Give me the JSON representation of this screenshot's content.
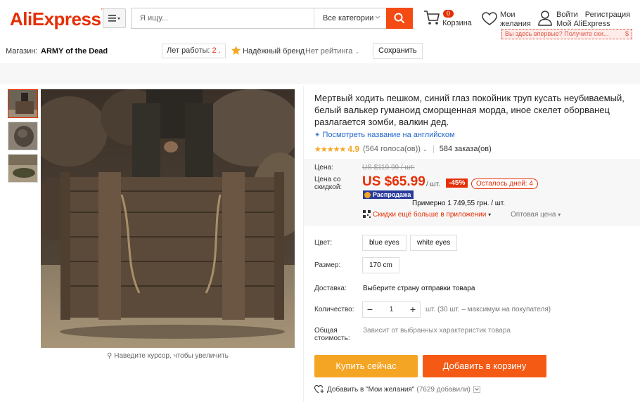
{
  "header": {
    "logo": "AliExpress",
    "search_placeholder": "Я ищу...",
    "category": "Все категории",
    "cart_count": "0",
    "cart_label": "Корзина",
    "wishlist_line1": "Мои",
    "wishlist_line2": "желания",
    "login": "Войти",
    "register": "Регистрация",
    "my_account": "Мой AliExpress",
    "promo": "Вы здесь впервые? Получите ски...",
    "promo_amount": "$"
  },
  "store": {
    "label": "Магазин:",
    "name": "ARMY of the Dead",
    "years_label": "Лет работы:",
    "years_value": "2 .",
    "brand": "Надёжный бренд",
    "rating": "Нет рейтинга",
    "save": "Сохранить"
  },
  "gallery": {
    "zoom_hint": "Наведите курсор, чтобы увеличить"
  },
  "product": {
    "title": "Мертвый ходить пешком, синий глаз покойник труп кусать неубиваемый, белый валькер гуманоид сморщенная морда, иное скелет оборванец разлагается зомби, валкин дед.",
    "translate_link": "Посмотреть название на английском",
    "stars": "★★★★★",
    "score": "4.9",
    "votes": "(564 голоса(ов))",
    "orders": "584 заказа(ов)",
    "price_label": "Цена:",
    "old_price": "US $119.99 / шт.",
    "sale_label_line1": "Цена со",
    "sale_label_line2": "скидкой:",
    "new_price": "US $65.99",
    "per_unit": "/ шт.",
    "discount": "-45%",
    "days_left": "Осталось дней: 4",
    "sale_badge": "Распродажа",
    "approx": "Примерно 1 749,55 грн. / шт.",
    "app_discount": "Скидки ещё больше в приложении",
    "wholesale": "Оптовая цена",
    "color_label": "Цвет:",
    "colors": [
      "blue eyes",
      "white eyes"
    ],
    "size_label": "Размер:",
    "size": "170 cm",
    "shipping_label": "Доставка:",
    "shipping_value": "Выберите страну отправки товара",
    "qty_label": "Количество:",
    "qty_value": "1",
    "qty_note": "шт. (30 шт. – максимум на покупателя)",
    "total_label_line1": "Общая",
    "total_label_line2": "стоимость:",
    "total_value": "Зависит от выбранных характеристик товара",
    "buy_now": "Купить сейчас",
    "add_to_cart": "Добавить в корзину",
    "wish_add": "Добавить в \"Мои желания\"",
    "wish_count": "(7629 добавили)"
  },
  "colors": {
    "brand_red": "#e62e04",
    "buy_orange": "#f5a524",
    "cart_orange": "#f45a14",
    "search_orange": "#f44b14",
    "link_blue": "#2266cc",
    "star_gold": "#f5a623"
  }
}
